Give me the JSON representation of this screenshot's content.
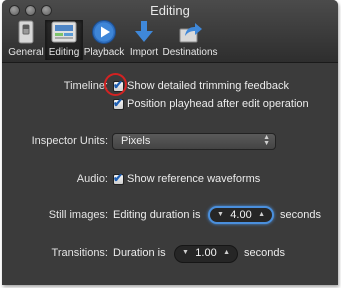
{
  "window": {
    "title": "Editing"
  },
  "toolbar": {
    "items": [
      {
        "label": "General",
        "icon": "switch-icon"
      },
      {
        "label": "Editing",
        "icon": "timeline-icon"
      },
      {
        "label": "Playback",
        "icon": "play-icon"
      },
      {
        "label": "Import",
        "icon": "download-arrow-icon"
      },
      {
        "label": "Destinations",
        "icon": "share-arrow-icon"
      }
    ],
    "selected": "Editing"
  },
  "timeline": {
    "label": "Timeline:",
    "option1": {
      "text": "Show detailed trimming feedback",
      "checked": true
    },
    "option2": {
      "text": "Position playhead after edit operation",
      "checked": true
    }
  },
  "inspector_units": {
    "label": "Inspector Units:",
    "value": "Pixels"
  },
  "audio": {
    "label": "Audio:",
    "option": {
      "text": "Show reference waveforms",
      "checked": true
    }
  },
  "still_images": {
    "label": "Still images:",
    "prefix": "Editing duration is",
    "value": "4.00",
    "suffix": "seconds"
  },
  "transitions": {
    "label": "Transitions:",
    "prefix": "Duration is",
    "value": "1.00",
    "suffix": "seconds"
  },
  "colors": {
    "focus_ring": "#4a8fdc",
    "checkmark": "#1e5fb3",
    "annotation_circle": "#d42222"
  }
}
